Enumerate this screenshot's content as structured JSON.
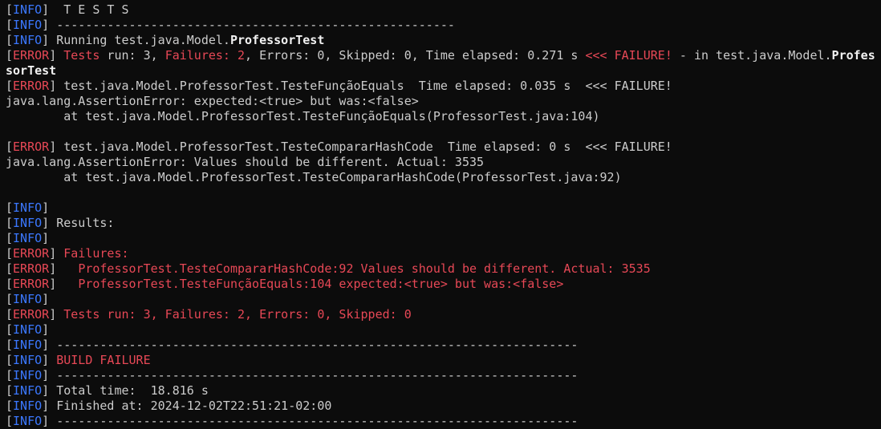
{
  "colors": {
    "background": "#0c0c0c",
    "text": "#cccccc",
    "info": "#3b78ff",
    "error": "#e74856",
    "bold": "#f2f2f2"
  },
  "terminal": {
    "lines": [
      {
        "segments": [
          {
            "text": "[",
            "style": "def"
          },
          {
            "text": "INFO",
            "style": "blue"
          },
          {
            "text": "]  T E S T S",
            "style": "def"
          }
        ]
      },
      {
        "segments": [
          {
            "text": "[",
            "style": "def"
          },
          {
            "text": "INFO",
            "style": "blue"
          },
          {
            "text": "] -------------------------------------------------------",
            "style": "def"
          }
        ]
      },
      {
        "segments": [
          {
            "text": "[",
            "style": "def"
          },
          {
            "text": "INFO",
            "style": "blue"
          },
          {
            "text": "] Running test.java.Model.",
            "style": "def"
          },
          {
            "text": "ProfessorTest",
            "style": "bold"
          }
        ]
      },
      {
        "segments": [
          {
            "text": "[",
            "style": "def"
          },
          {
            "text": "ERROR",
            "style": "red"
          },
          {
            "text": "] ",
            "style": "def"
          },
          {
            "text": "Tests",
            "style": "red"
          },
          {
            "text": " run: 3, ",
            "style": "def"
          },
          {
            "text": "Failures: 2",
            "style": "red"
          },
          {
            "text": ", Errors: 0, Skipped: 0, Time elapsed: 0.271 s ",
            "style": "def"
          },
          {
            "text": "<<< FAILURE!",
            "style": "red"
          },
          {
            "text": " - in test.java.Model.",
            "style": "def"
          },
          {
            "text": "Profes",
            "style": "bold"
          }
        ]
      },
      {
        "segments": [
          {
            "text": "sorTest",
            "style": "bold"
          }
        ]
      },
      {
        "segments": [
          {
            "text": "[",
            "style": "def"
          },
          {
            "text": "ERROR",
            "style": "red"
          },
          {
            "text": "] test.java.Model.ProfessorTest.TesteFunçãoEquals  Time elapsed: 0.035 s  <<< FAILURE!",
            "style": "def"
          }
        ]
      },
      {
        "segments": [
          {
            "text": "java.lang.AssertionError: expected:<true> but was:<false>",
            "style": "def"
          }
        ]
      },
      {
        "segments": [
          {
            "text": "        at test.java.Model.ProfessorTest.TesteFunçãoEquals(ProfessorTest.java:104)",
            "style": "def"
          }
        ]
      },
      {
        "segments": []
      },
      {
        "segments": [
          {
            "text": "[",
            "style": "def"
          },
          {
            "text": "ERROR",
            "style": "red"
          },
          {
            "text": "] test.java.Model.ProfessorTest.TesteCompararHashCode  Time elapsed: 0 s  <<< FAILURE!",
            "style": "def"
          }
        ]
      },
      {
        "segments": [
          {
            "text": "java.lang.AssertionError: Values should be different. Actual: 3535",
            "style": "def"
          }
        ]
      },
      {
        "segments": [
          {
            "text": "        at test.java.Model.ProfessorTest.TesteCompararHashCode(ProfessorTest.java:92)",
            "style": "def"
          }
        ]
      },
      {
        "segments": []
      },
      {
        "segments": [
          {
            "text": "[",
            "style": "def"
          },
          {
            "text": "INFO",
            "style": "blue"
          },
          {
            "text": "]",
            "style": "def"
          }
        ]
      },
      {
        "segments": [
          {
            "text": "[",
            "style": "def"
          },
          {
            "text": "INFO",
            "style": "blue"
          },
          {
            "text": "] Results:",
            "style": "def"
          }
        ]
      },
      {
        "segments": [
          {
            "text": "[",
            "style": "def"
          },
          {
            "text": "INFO",
            "style": "blue"
          },
          {
            "text": "]",
            "style": "def"
          }
        ]
      },
      {
        "segments": [
          {
            "text": "[",
            "style": "def"
          },
          {
            "text": "ERROR",
            "style": "red"
          },
          {
            "text": "] ",
            "style": "def"
          },
          {
            "text": "Failures:",
            "style": "red"
          }
        ]
      },
      {
        "segments": [
          {
            "text": "[",
            "style": "def"
          },
          {
            "text": "ERROR",
            "style": "red"
          },
          {
            "text": "]   ",
            "style": "def"
          },
          {
            "text": "ProfessorTest.TesteCompararHashCode:92 Values should be different. Actual: 3535",
            "style": "red"
          }
        ]
      },
      {
        "segments": [
          {
            "text": "[",
            "style": "def"
          },
          {
            "text": "ERROR",
            "style": "red"
          },
          {
            "text": "]   ",
            "style": "def"
          },
          {
            "text": "ProfessorTest.TesteFunçãoEquals:104 expected:<true> but was:<false>",
            "style": "red"
          }
        ]
      },
      {
        "segments": [
          {
            "text": "[",
            "style": "def"
          },
          {
            "text": "INFO",
            "style": "blue"
          },
          {
            "text": "]",
            "style": "def"
          }
        ]
      },
      {
        "segments": [
          {
            "text": "[",
            "style": "def"
          },
          {
            "text": "ERROR",
            "style": "red"
          },
          {
            "text": "] ",
            "style": "def"
          },
          {
            "text": "Tests run: 3, Failures: 2, Errors: 0, Skipped: 0",
            "style": "red"
          }
        ]
      },
      {
        "segments": [
          {
            "text": "[",
            "style": "def"
          },
          {
            "text": "INFO",
            "style": "blue"
          },
          {
            "text": "]",
            "style": "def"
          }
        ]
      },
      {
        "segments": [
          {
            "text": "[",
            "style": "def"
          },
          {
            "text": "INFO",
            "style": "blue"
          },
          {
            "text": "] ------------------------------------------------------------------------",
            "style": "def"
          }
        ]
      },
      {
        "segments": [
          {
            "text": "[",
            "style": "def"
          },
          {
            "text": "INFO",
            "style": "blue"
          },
          {
            "text": "] ",
            "style": "def"
          },
          {
            "text": "BUILD FAILURE",
            "style": "red"
          }
        ]
      },
      {
        "segments": [
          {
            "text": "[",
            "style": "def"
          },
          {
            "text": "INFO",
            "style": "blue"
          },
          {
            "text": "] ------------------------------------------------------------------------",
            "style": "def"
          }
        ]
      },
      {
        "segments": [
          {
            "text": "[",
            "style": "def"
          },
          {
            "text": "INFO",
            "style": "blue"
          },
          {
            "text": "] Total time:  18.816 s",
            "style": "def"
          }
        ]
      },
      {
        "segments": [
          {
            "text": "[",
            "style": "def"
          },
          {
            "text": "INFO",
            "style": "blue"
          },
          {
            "text": "] Finished at: 2024-12-02T22:51:21-02:00",
            "style": "def"
          }
        ]
      },
      {
        "segments": [
          {
            "text": "[",
            "style": "def"
          },
          {
            "text": "INFO",
            "style": "blue"
          },
          {
            "text": "] ------------------------------------------------------------------------",
            "style": "def"
          }
        ]
      }
    ]
  }
}
